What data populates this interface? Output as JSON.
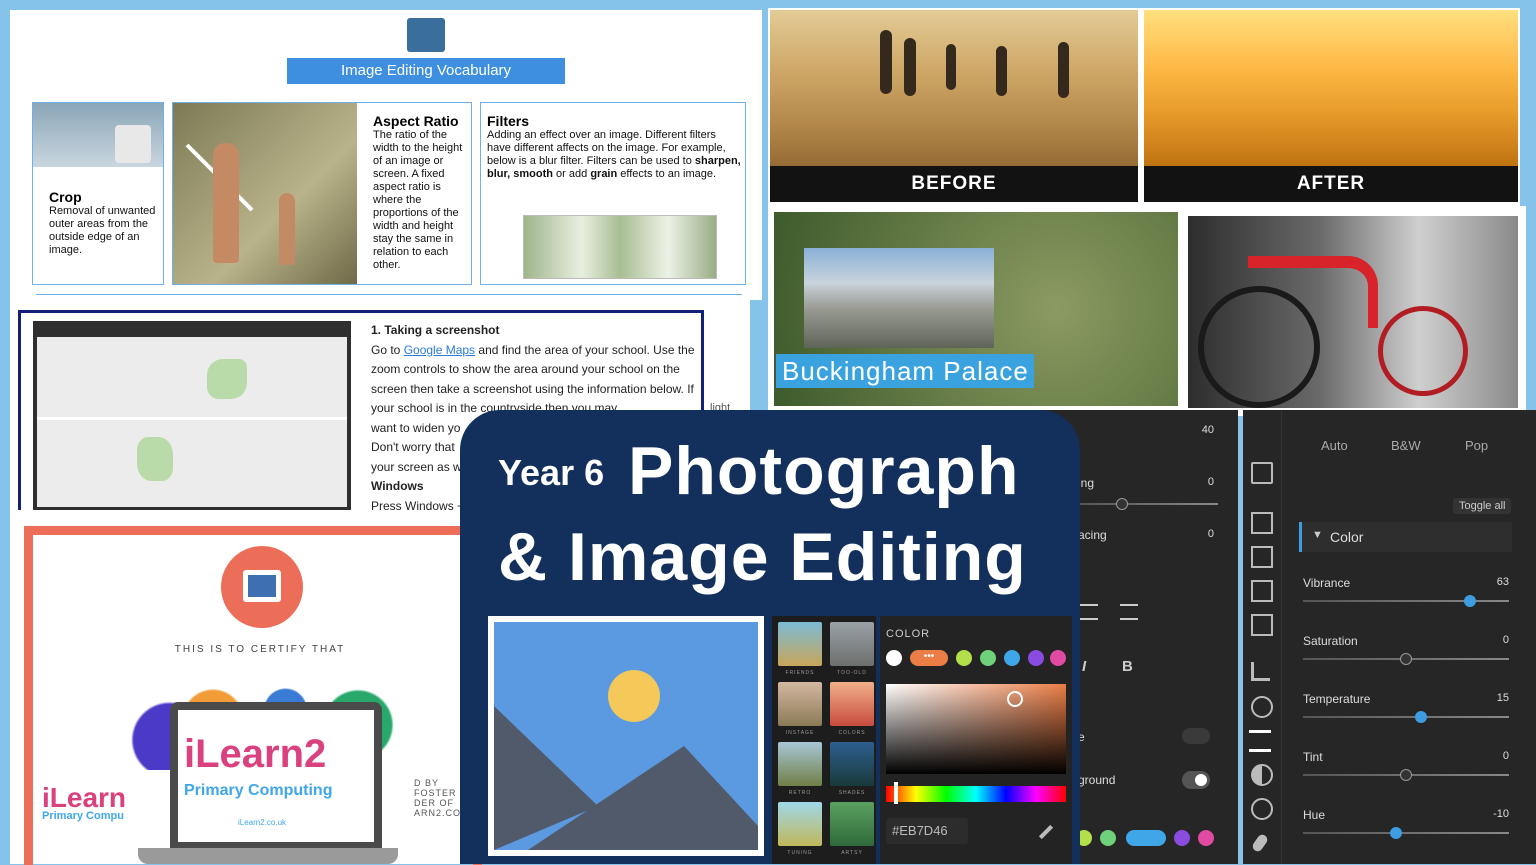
{
  "vocab": {
    "title": "Image Editing Vocabulary",
    "crop": {
      "heading": "Crop",
      "text": "Removal of unwanted outer areas from the outside edge of an image."
    },
    "aspect": {
      "heading": "Aspect Ratio",
      "text": "The ratio of the width to the height of an image or screen. A fixed aspect ratio is where the proportions of the width and height stay the same in relation to each other."
    },
    "filters": {
      "heading": "Filters",
      "text_plain": "Adding an effect over an image. Different filters have different affects on the image. For example, below is a blur filter. Filters can be used to ",
      "bold1": "sharpen, blur, smooth",
      "text_mid": " or add ",
      "bold2": "grain",
      "text_end": " effects to an image."
    }
  },
  "sheet": {
    "heading": "1. Taking a screenshot",
    "p1_start": "Go to ",
    "link": "Google Maps",
    "p1_end": " and find the area of your school. Use the zoom controls to show the area around your school on the screen then take a screenshot using the information below. If your school is in the countryside then you may",
    "p2": "want to widen yo",
    "p3": "Don't worry that",
    "p4": "your screen as w",
    "windows": "Windows",
    "p5": "Press Windows +",
    "right_word": "light"
  },
  "photos": {
    "before": "BEFORE",
    "after": "AFTER",
    "palace": "Buckingham Palace"
  },
  "card": {
    "year": "Year 6",
    "title1": "Photograph",
    "title2": "& Image Editing",
    "filters": [
      "FRIENDS",
      "TOO-OLD",
      "INSTAGE",
      "COLORS",
      "RETRO",
      "SHADES",
      "TUNING",
      "ARTSY"
    ],
    "color_heading": "COLOR",
    "hex": "#EB7D46"
  },
  "midpanel": {
    "value_top": "40",
    "row1": "ing",
    "row1_val": "0",
    "row2": "acing",
    "row2_val": "0",
    "italic": "I",
    "bold": "B",
    "toggle1": "e",
    "toggle2": "ground"
  },
  "rightpanel": {
    "presets": [
      "Auto",
      "B&W",
      "Pop"
    ],
    "toggle_all": "Toggle all",
    "section": "Color",
    "sliders": [
      {
        "label": "Vibrance",
        "value": "63",
        "pos": 0.81
      },
      {
        "label": "Saturation",
        "value": "0",
        "pos": 0.5
      },
      {
        "label": "Temperature",
        "value": "15",
        "pos": 0.575
      },
      {
        "label": "Tint",
        "value": "0",
        "pos": 0.5
      },
      {
        "label": "Hue",
        "value": "-10",
        "pos": 0.45
      }
    ]
  },
  "cert": {
    "certify": "THIS IS TO CERTIFY THAT",
    "brand": "iLearn2",
    "brand_sub": "Primary Computing",
    "brand_url": "iLearn2.co.uk",
    "left_brand": "iLearn",
    "left_sub": "Primary Compu",
    "right_small1": "D BY",
    "right_small2": "FOSTER",
    "right_small3": "DER OF",
    "right_small4": "ARN2.CO.UK"
  },
  "colors": {
    "accent": "#3e8fe0",
    "card": "#12305b",
    "cert_border": "#ed6e58",
    "swatch": "#EB7D46"
  }
}
